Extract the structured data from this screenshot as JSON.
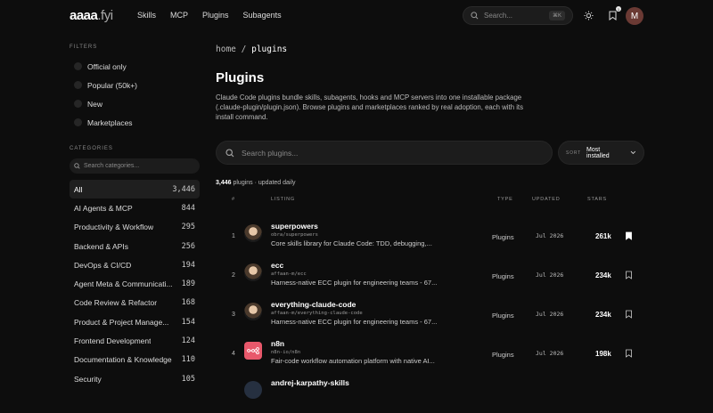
{
  "header": {
    "logo": "aaaa",
    "logo_suffix": ".fyi",
    "nav": [
      "Skills",
      "MCP",
      "Plugins",
      "Subagents"
    ],
    "search_placeholder": "Search...",
    "search_kbd": "⌘K",
    "notification_count": "1",
    "avatar_initial": "M"
  },
  "sidebar": {
    "filters_title": "FILTERS",
    "filters": [
      "Official only",
      "Popular (50k+)",
      "New",
      "Marketplaces"
    ],
    "categories_title": "CATEGORIES",
    "category_search_placeholder": "Search categories...",
    "categories": [
      {
        "name": "All",
        "count": "3,446"
      },
      {
        "name": "AI Agents & MCP",
        "count": "844"
      },
      {
        "name": "Productivity & Workflow",
        "count": "295"
      },
      {
        "name": "Backend & APIs",
        "count": "256"
      },
      {
        "name": "DevOps & CI/CD",
        "count": "194"
      },
      {
        "name": "Agent Meta & Communicati...",
        "count": "189"
      },
      {
        "name": "Code Review & Refactor",
        "count": "168"
      },
      {
        "name": "Product & Project Manage...",
        "count": "154"
      },
      {
        "name": "Frontend Development",
        "count": "124"
      },
      {
        "name": "Documentation & Knowledge",
        "count": "110"
      },
      {
        "name": "Security",
        "count": "105"
      }
    ]
  },
  "main": {
    "breadcrumb_home": "home",
    "breadcrumb_sep": "/",
    "breadcrumb_current": "plugins",
    "title": "Plugins",
    "description": "Claude Code plugins bundle skills, subagents, hooks and MCP servers into one installable package (.claude-plugin/plugin.json). Browse plugins and marketplaces ranked by real adoption, each with its install command.",
    "search_placeholder": "Search plugins...",
    "sort_label": "SORT",
    "sort_value": "Most installed",
    "count_value": "3,446",
    "count_unit": "plugins",
    "count_suffix": "· updated daily",
    "columns": {
      "num": "#",
      "listing": "LISTING",
      "type": "TYPE",
      "updated": "UPDATED",
      "stars": "STARS"
    },
    "rows": [
      {
        "num": "1",
        "title": "superpowers",
        "slug": "obra/superpowers",
        "sub": "Core skills library for Claude Code: TDD, debugging,...",
        "type": "Plugins",
        "updated": "Jul 2026",
        "stars": "261k",
        "saved": true
      },
      {
        "num": "2",
        "title": "ecc",
        "slug": "affaan-m/ecc",
        "sub": "Harness-native ECC plugin for engineering teams - 67...",
        "type": "Plugins",
        "updated": "Jul 2026",
        "stars": "234k",
        "saved": false
      },
      {
        "num": "3",
        "title": "everything-claude-code",
        "slug": "affaan-m/everything-claude-code",
        "sub": "Harness-native ECC plugin for engineering teams - 67...",
        "type": "Plugins",
        "updated": "Jul 2026",
        "stars": "234k",
        "saved": false
      },
      {
        "num": "4",
        "title": "n8n",
        "slug": "n8n-io/n8n",
        "sub": "Fair-code workflow automation platform with native AI...",
        "type": "Plugins",
        "updated": "Jul 2026",
        "stars": "198k",
        "saved": false
      },
      {
        "num": "",
        "title": "andrej-karpathy-skills",
        "slug": "",
        "sub": "",
        "type": "",
        "updated": "",
        "stars": "",
        "saved": false
      }
    ]
  }
}
